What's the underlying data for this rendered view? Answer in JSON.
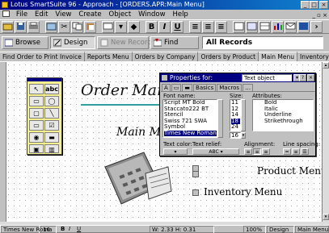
{
  "window": {
    "title": "Lotus SmartSuite 96 - Approach - [ORDERS.APR:Main Menu]"
  },
  "menu": [
    "File",
    "Edit",
    "View",
    "Create",
    "Object",
    "Window",
    "Help"
  ],
  "toolbar": {
    "bold": "B",
    "italic": "I",
    "underline": "U"
  },
  "actionbar": {
    "browse": "Browse",
    "design": "Design",
    "new_record": "New Record",
    "find": "Find",
    "records": "All Records"
  },
  "tabs": [
    "Find Order to Print Invoice",
    "Reports Menu",
    "Orders by Company",
    "Orders by Product",
    "Main Menu",
    "Inventory Menu"
  ],
  "active_tab": "Main Menu",
  "tools": {
    "text_tool": "abc"
  },
  "form": {
    "title": "Order Manc",
    "subtitle": "Main Me",
    "product_menu": "Product Menu",
    "inventory_menu": "Inventory Menu"
  },
  "properties": {
    "title": "Properties for:",
    "object": "Text object",
    "tabs": [
      "Basics",
      "Macros"
    ],
    "font_name_label": "Font name:",
    "size_label": "Size:",
    "attributes_label": "Attributes:",
    "fonts": [
      "Script MT Bold",
      "Staccato222 BT",
      "Stencil",
      "Swiss 721 SWA",
      "Symbol",
      "Times New Roman"
    ],
    "selected_font": "Times New Roman",
    "sizes": [
      "11",
      "12",
      "14",
      "18",
      "24"
    ],
    "selected_size": "18",
    "size_value": "16",
    "attributes": [
      "Bold",
      "Italic",
      "Underline",
      "Strikethrough"
    ],
    "text_color_label": "Text color:",
    "text_relief_label": "Text relief:",
    "relief_value": "ABC",
    "alignment_label": "Alignment:",
    "line_spacing_label": "Line spacing:"
  },
  "status": {
    "font": "Times New Roma",
    "size": "16",
    "bold": "B",
    "italic": "I",
    "underline": "U",
    "coords": "W: 2.33 H: 0.31",
    "zoom": "100%",
    "mode": "Design",
    "view": "Main Menu"
  }
}
